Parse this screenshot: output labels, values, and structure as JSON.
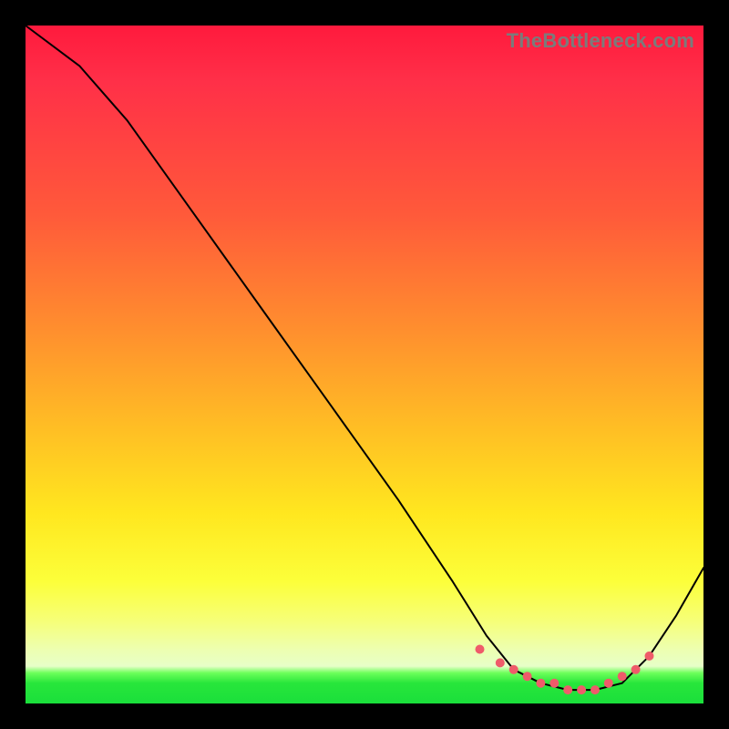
{
  "watermark": "TheBottleneck.com",
  "colors": {
    "dot": "#ef5b6a",
    "line": "#000000",
    "frame_bg": "#000000"
  },
  "chart_data": {
    "type": "line",
    "title": "",
    "xlabel": "",
    "ylabel": "",
    "xlim": [
      0,
      100
    ],
    "ylim": [
      0,
      100
    ],
    "grid": false,
    "legend": false,
    "note": "Axes are unlabeled; values are relative percentages estimated from pixel positions (x left→right, y bottom→top). The curve descends steeply from top-left, flattens near the bottom around x≈70–88, then rises toward the right edge. Dots highlight the flat-bottom region.",
    "series": [
      {
        "name": "curve",
        "x": [
          0,
          8,
          15,
          25,
          35,
          45,
          55,
          63,
          68,
          72,
          76,
          80,
          84,
          88,
          92,
          96,
          100
        ],
        "y": [
          100,
          94,
          86,
          72,
          58,
          44,
          30,
          18,
          10,
          5,
          3,
          2,
          2,
          3,
          7,
          13,
          20
        ]
      }
    ],
    "markers": {
      "name": "bottom-dots",
      "x": [
        67,
        70,
        72,
        74,
        76,
        78,
        80,
        82,
        84,
        86,
        88,
        90,
        92
      ],
      "y": [
        8,
        6,
        5,
        4,
        3,
        3,
        2,
        2,
        2,
        3,
        4,
        5,
        7
      ]
    }
  }
}
